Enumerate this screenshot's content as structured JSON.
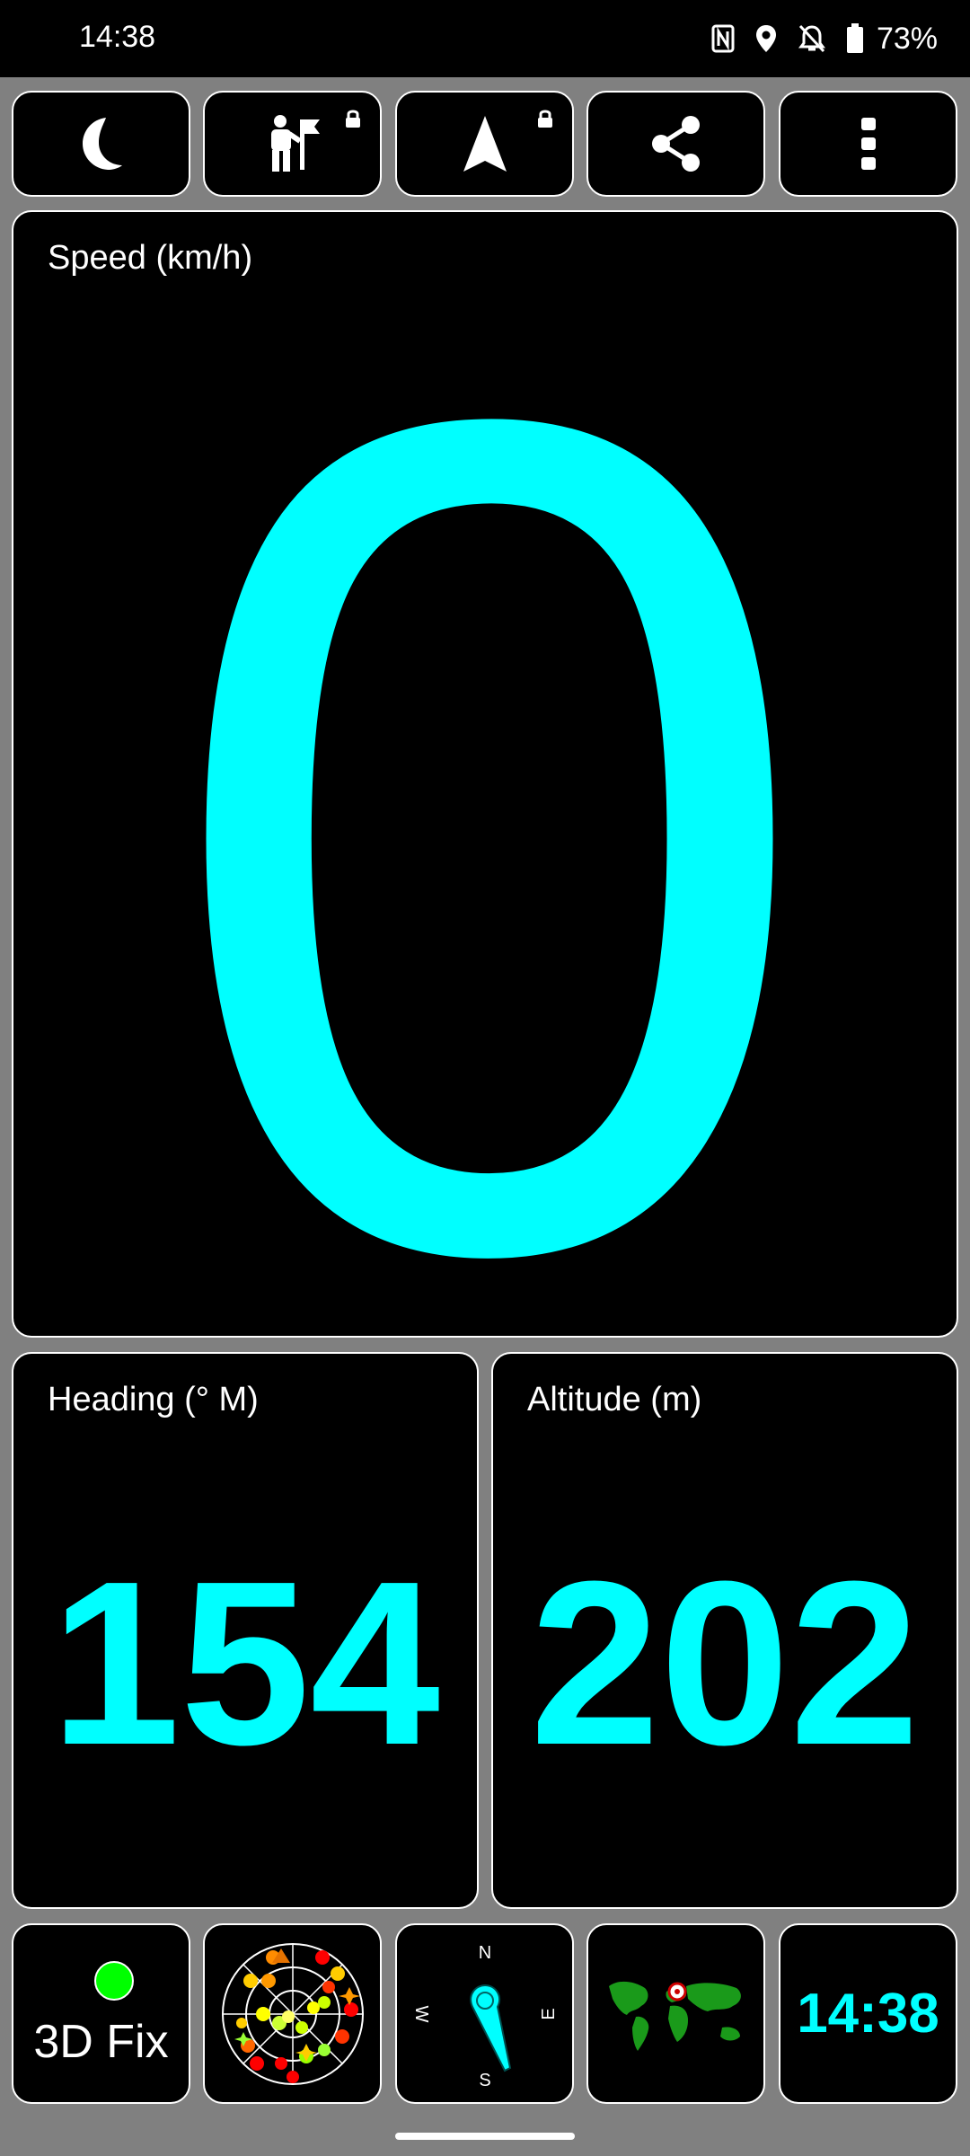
{
  "status_bar": {
    "time": "14:38",
    "battery_percent": "73%",
    "icons": [
      "nfc-icon",
      "location-icon",
      "notifications-off-icon",
      "battery-icon"
    ]
  },
  "toolbar": {
    "buttons": [
      {
        "icon": "moon-icon",
        "locked": false
      },
      {
        "icon": "hiker-flag-icon",
        "locked": true
      },
      {
        "icon": "navigation-arrow-icon",
        "locked": true
      },
      {
        "icon": "share-icon",
        "locked": false
      },
      {
        "icon": "more-vert-icon",
        "locked": false
      }
    ]
  },
  "speed": {
    "label": "Speed (km/h)",
    "value": "0"
  },
  "heading": {
    "label": "Heading (° M)",
    "value": "154"
  },
  "altitude": {
    "label": "Altitude (m)",
    "value": "202"
  },
  "bottom_bar": {
    "fix_status": "3D Fix",
    "compass": {
      "n": "N",
      "e": "E",
      "s": "S",
      "w": "W"
    },
    "clock": "14:38"
  },
  "colors": {
    "accent": "#00ffff",
    "background": "#808080",
    "panel": "#000000",
    "fix_indicator": "#00ff00",
    "map_land": "#1a9a1a"
  }
}
